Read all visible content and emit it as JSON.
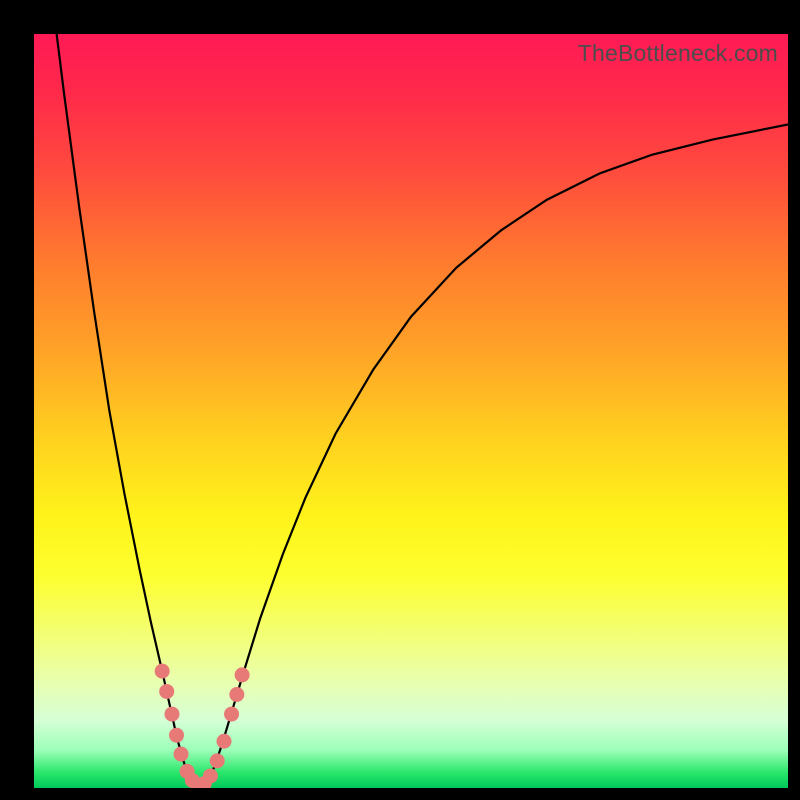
{
  "watermark": "TheBottleneck.com",
  "colors": {
    "frame": "#000000",
    "curve_stroke": "#000000",
    "marker_fill": "#e77a77",
    "marker_stroke": "#c95a55"
  },
  "chart_data": {
    "type": "line",
    "title": "",
    "xlabel": "",
    "ylabel": "",
    "xlim": [
      0,
      100
    ],
    "ylim": [
      0,
      100
    ],
    "grid": false,
    "curve": [
      {
        "x": 3.0,
        "y": 100.0
      },
      {
        "x": 4.0,
        "y": 92.0
      },
      {
        "x": 6.0,
        "y": 77.0
      },
      {
        "x": 8.0,
        "y": 63.0
      },
      {
        "x": 10.0,
        "y": 50.0
      },
      {
        "x": 12.0,
        "y": 39.0
      },
      {
        "x": 14.0,
        "y": 29.0
      },
      {
        "x": 15.5,
        "y": 22.0
      },
      {
        "x": 17.0,
        "y": 15.5
      },
      {
        "x": 18.0,
        "y": 11.0
      },
      {
        "x": 19.0,
        "y": 6.5
      },
      {
        "x": 20.0,
        "y": 3.0
      },
      {
        "x": 20.8,
        "y": 1.2
      },
      {
        "x": 21.6,
        "y": 0.4
      },
      {
        "x": 22.4,
        "y": 0.4
      },
      {
        "x": 23.2,
        "y": 1.2
      },
      {
        "x": 24.0,
        "y": 3.0
      },
      {
        "x": 25.0,
        "y": 6.0
      },
      {
        "x": 26.5,
        "y": 11.0
      },
      {
        "x": 28.0,
        "y": 16.0
      },
      {
        "x": 30.0,
        "y": 22.5
      },
      {
        "x": 33.0,
        "y": 31.0
      },
      {
        "x": 36.0,
        "y": 38.5
      },
      {
        "x": 40.0,
        "y": 47.0
      },
      {
        "x": 45.0,
        "y": 55.5
      },
      {
        "x": 50.0,
        "y": 62.5
      },
      {
        "x": 56.0,
        "y": 69.0
      },
      {
        "x": 62.0,
        "y": 74.0
      },
      {
        "x": 68.0,
        "y": 78.0
      },
      {
        "x": 75.0,
        "y": 81.5
      },
      {
        "x": 82.0,
        "y": 84.0
      },
      {
        "x": 90.0,
        "y": 86.0
      },
      {
        "x": 100.0,
        "y": 88.0
      }
    ],
    "markers": [
      {
        "x": 17.0,
        "y": 15.5
      },
      {
        "x": 17.6,
        "y": 12.8
      },
      {
        "x": 18.3,
        "y": 9.8
      },
      {
        "x": 18.9,
        "y": 7.0
      },
      {
        "x": 19.5,
        "y": 4.5
      },
      {
        "x": 20.3,
        "y": 2.2
      },
      {
        "x": 21.0,
        "y": 1.0
      },
      {
        "x": 21.8,
        "y": 0.4
      },
      {
        "x": 22.6,
        "y": 0.6
      },
      {
        "x": 23.4,
        "y": 1.6
      },
      {
        "x": 24.3,
        "y": 3.6
      },
      {
        "x": 25.2,
        "y": 6.2
      },
      {
        "x": 26.2,
        "y": 9.8
      },
      {
        "x": 26.9,
        "y": 12.4
      },
      {
        "x": 27.6,
        "y": 15.0
      }
    ],
    "marker_radius_px": 7.5
  }
}
